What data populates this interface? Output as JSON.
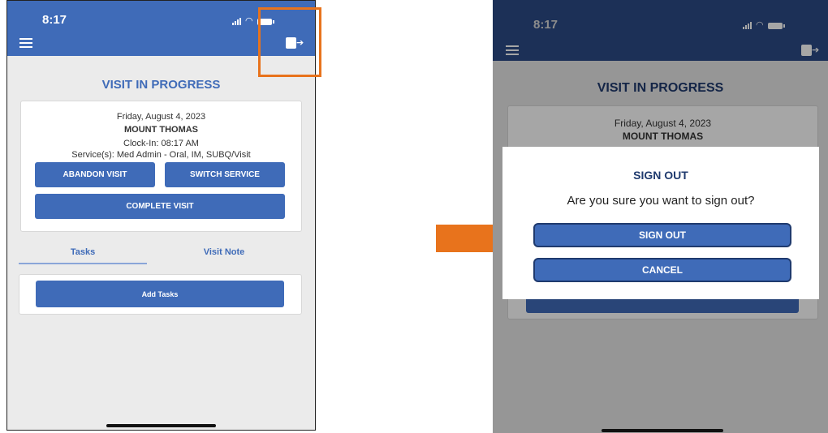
{
  "colors": {
    "brand_blue": "#3f6bb8",
    "dark_blue": "#1f3a6e",
    "accent_orange": "#e8731c"
  },
  "left_phone": {
    "status_time": "8:17",
    "visit_title": "VISIT IN PROGRESS",
    "visit_card": {
      "date": "Friday, August 4, 2023",
      "client_name": "MOUNT THOMAS",
      "clock_in": "Clock-In: 08:17 AM",
      "services": "Service(s): Med Admin - Oral, IM, SUBQ/Visit"
    },
    "buttons": {
      "abandon_visit": "ABANDON VISIT",
      "switch_service": "SWITCH SERVICE",
      "complete_visit": "COMPLETE VISIT",
      "add_tasks": "Add Tasks"
    },
    "tabs": [
      "Tasks",
      "Visit Note"
    ]
  },
  "right_phone": {
    "status_time": "8:17",
    "visit_title": "VISIT IN PROGRESS",
    "visit_card": {
      "date": "Friday, August 4, 2023",
      "client_name": "MOUNT THOMAS"
    },
    "dialog": {
      "title": "SIGN OUT",
      "message": "Are you sure you want to sign out?",
      "confirm_label": "SIGN OUT",
      "cancel_label": "CANCEL"
    }
  },
  "icons": {
    "menu": "hamburger-menu-icon",
    "sign_out": "sign-out-icon",
    "signal": "signal-icon",
    "wifi": "wifi-icon",
    "battery": "battery-icon",
    "arrow": "orange-arrow-icon"
  }
}
